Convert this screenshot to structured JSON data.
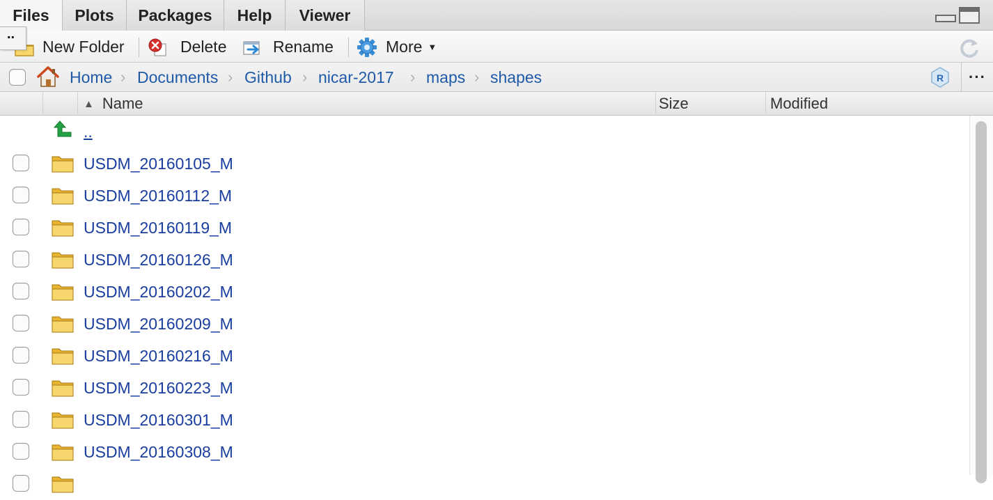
{
  "tabs": [
    {
      "label": "Files"
    },
    {
      "label": "Plots"
    },
    {
      "label": "Packages"
    },
    {
      "label": "Help"
    },
    {
      "label": "Viewer"
    }
  ],
  "active_tab": "Files",
  "toolbar": {
    "new_folder": "New Folder",
    "delete": "Delete",
    "rename": "Rename",
    "more": "More",
    "parent_tooltip": ".."
  },
  "breadcrumb": [
    "Home",
    "Documents",
    "Github",
    "nicar-2017",
    "maps",
    "shapes"
  ],
  "breadcrumb_more": "···",
  "columns": {
    "name": "Name",
    "size": "Size",
    "modified": "Modified"
  },
  "parent_link": "..",
  "files": [
    {
      "name": "USDM_20160105_M"
    },
    {
      "name": "USDM_20160112_M"
    },
    {
      "name": "USDM_20160119_M"
    },
    {
      "name": "USDM_20160126_M"
    },
    {
      "name": "USDM_20160202_M"
    },
    {
      "name": "USDM_20160209_M"
    },
    {
      "name": "USDM_20160216_M"
    },
    {
      "name": "USDM_20160223_M"
    },
    {
      "name": "USDM_20160301_M"
    },
    {
      "name": "USDM_20160308_M"
    }
  ],
  "icons": {
    "home": "home-icon",
    "folder": "folder-icon",
    "parent": "up-arrow-icon",
    "delete": "delete-icon",
    "rename": "rename-icon",
    "more": "gear-icon",
    "refresh": "refresh-icon",
    "project": "r-project-icon"
  },
  "colors": {
    "link": "#1f5aa8",
    "file_link": "#1a3ea0",
    "folder": "#e9b530",
    "up_arrow": "#1e9a3c"
  }
}
